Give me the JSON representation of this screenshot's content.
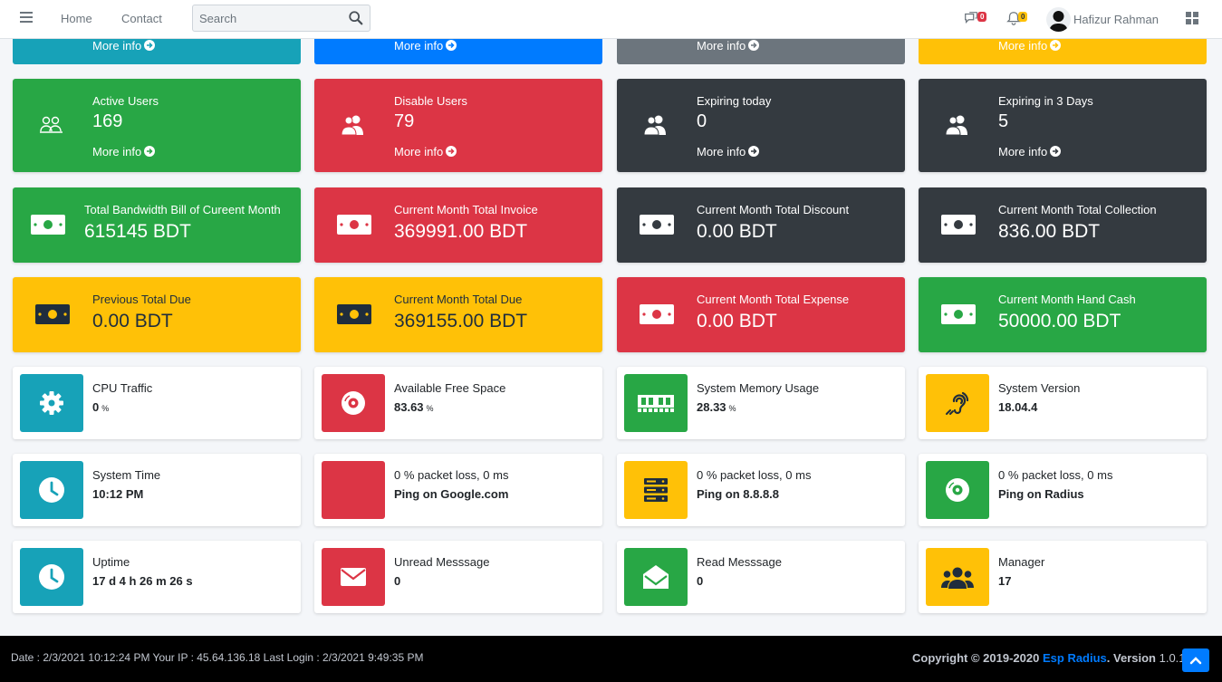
{
  "nav": {
    "home": "Home",
    "contact": "Contact",
    "search_placeholder": "Search",
    "messages_count": "0",
    "notifications_count": "0",
    "user_name": "Hafizur Rahman"
  },
  "colors": {
    "teal": "#17a2b8",
    "blue": "#007bff",
    "gray": "#6c757d",
    "yellow": "#ffc107",
    "green": "#28a745",
    "red": "#dc3545",
    "dark": "#343a40"
  },
  "top_strip": {
    "more": "More info"
  },
  "user_cards": [
    {
      "label": "Active Users",
      "value": "169",
      "more": "More info",
      "icon": "users-outline-icon",
      "color": "green"
    },
    {
      "label": "Disable Users",
      "value": "79",
      "more": "More info",
      "icon": "users-icon",
      "color": "red"
    },
    {
      "label": "Expiring today",
      "value": "0",
      "more": "More info",
      "icon": "users-icon",
      "color": "dark"
    },
    {
      "label": "Expiring in 3 Days",
      "value": "5",
      "more": "More info",
      "icon": "users-icon",
      "color": "dark"
    }
  ],
  "money_row1": [
    {
      "label": "Total Bandwidth Bill of Cureent Month",
      "value": "615145 BDT",
      "color": "green"
    },
    {
      "label": "Current Month Total Invoice",
      "value": "369991.00 BDT",
      "color": "red"
    },
    {
      "label": "Current Month Total Discount",
      "value": "0.00 BDT",
      "color": "dark"
    },
    {
      "label": "Current Month Total Collection",
      "value": "836.00 BDT",
      "color": "dark"
    }
  ],
  "money_row2": [
    {
      "label": "Previous Total Due",
      "value": "0.00 BDT",
      "color": "yellow"
    },
    {
      "label": "Current Month Total Due",
      "value": "369155.00 BDT",
      "color": "yellow"
    },
    {
      "label": "Current Month Total Expense",
      "value": "0.00 BDT",
      "color": "red"
    },
    {
      "label": "Current Month Hand Cash",
      "value": "50000.00 BDT",
      "color": "green"
    }
  ],
  "info_row1": [
    {
      "label": "CPU Traffic",
      "value": "0",
      "unit": "%",
      "icon": "gear-icon",
      "color": "teal"
    },
    {
      "label": "Available Free Space",
      "value": "83.63",
      "unit": "%",
      "icon": "disk-icon",
      "color": "red"
    },
    {
      "label": "System Memory Usage",
      "value": "28.33",
      "unit": "%",
      "icon": "memory-icon",
      "color": "green"
    },
    {
      "label": "System Version",
      "value": "18.04.4",
      "unit": "",
      "icon": "assistive-listening-icon",
      "color": "yellow"
    }
  ],
  "info_row2": [
    {
      "label": "System Time",
      "value": "10:12 PM",
      "icon": "clock-icon",
      "color": "teal"
    },
    {
      "label": "0 % packet loss, 0 ms",
      "value": "Ping on Google.com",
      "icon": "",
      "color": "red"
    },
    {
      "label": "0 % packet loss, 0 ms",
      "value": "Ping on 8.8.8.8",
      "icon": "server-icon",
      "color": "yellow"
    },
    {
      "label": "0 % packet loss, 0 ms",
      "value": "Ping on Radius",
      "icon": "disk-icon",
      "color": "green"
    }
  ],
  "info_row3": [
    {
      "label": "Uptime",
      "value": "17 d 4 h 26 m 26 s",
      "icon": "clock-icon",
      "color": "teal"
    },
    {
      "label": "Unread Messsage",
      "value": "0",
      "icon": "envelope-icon",
      "color": "red"
    },
    {
      "label": "Read Messsage",
      "value": "0",
      "icon": "envelope-open-icon",
      "color": "green"
    },
    {
      "label": "Manager",
      "value": "17",
      "icon": "user-group-icon",
      "color": "yellow"
    }
  ],
  "footer": {
    "info": "Date : 2/3/2021 10:12:24 PM Your IP : 45.64.136.18 Last Login : 2/3/2021 9:49:35 PM",
    "copyright": "Copyright © 2019-2020",
    "brand": "Esp Radius",
    "version_label": ". Version",
    "version": "1.0.1"
  }
}
